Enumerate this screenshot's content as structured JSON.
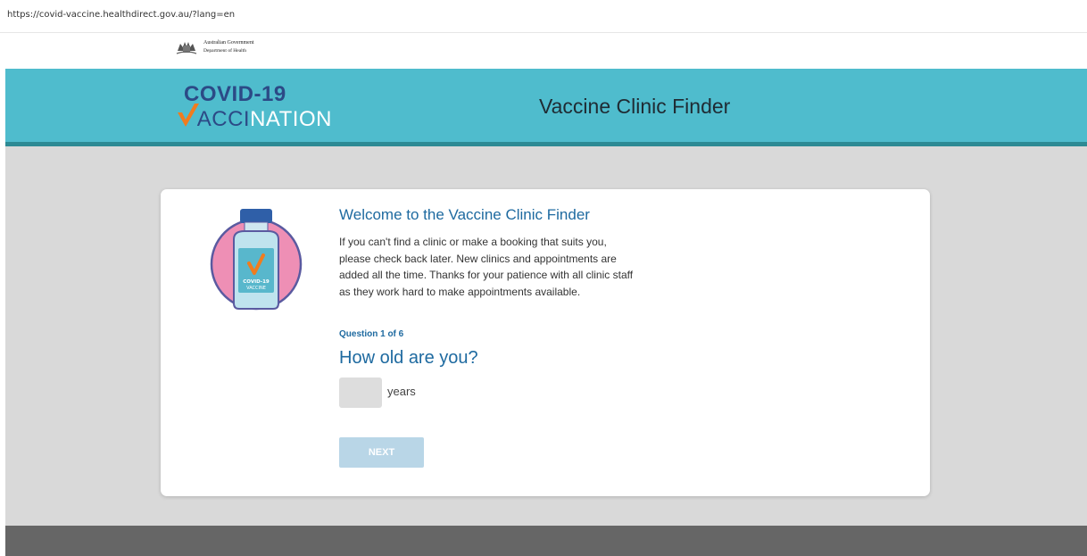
{
  "browser": {
    "url": "https://covid-vaccine.healthdirect.gov.au/?lang=en"
  },
  "gov_banner": {
    "line1": "Australian Government",
    "line2": "Department of Health"
  },
  "header": {
    "logo_line1": "COVID-19",
    "logo_line2_colored": "ACCI",
    "logo_line2_white": "NATION",
    "title": "Vaccine Clinic Finder",
    "band_color": "#4fbccd",
    "accent_color": "#2d8a94"
  },
  "illustration": {
    "label_line1": "COVID-19",
    "label_line2": "VACCINE"
  },
  "card": {
    "welcome_title": "Welcome to the Vaccine Clinic Finder",
    "body_lines": [
      "If you can't find a clinic or make a booking that suits you,",
      "please check back later. New clinics and appointments are",
      "added all the time. Thanks for your patience with all clinic staff",
      "as they work hard to make appointments available."
    ],
    "question_count": "Question 1 of 6",
    "question_title": "How old are you?",
    "age_value": "",
    "age_unit": "years",
    "next_label": "NEXT",
    "next_color": "#b9d6e7"
  }
}
